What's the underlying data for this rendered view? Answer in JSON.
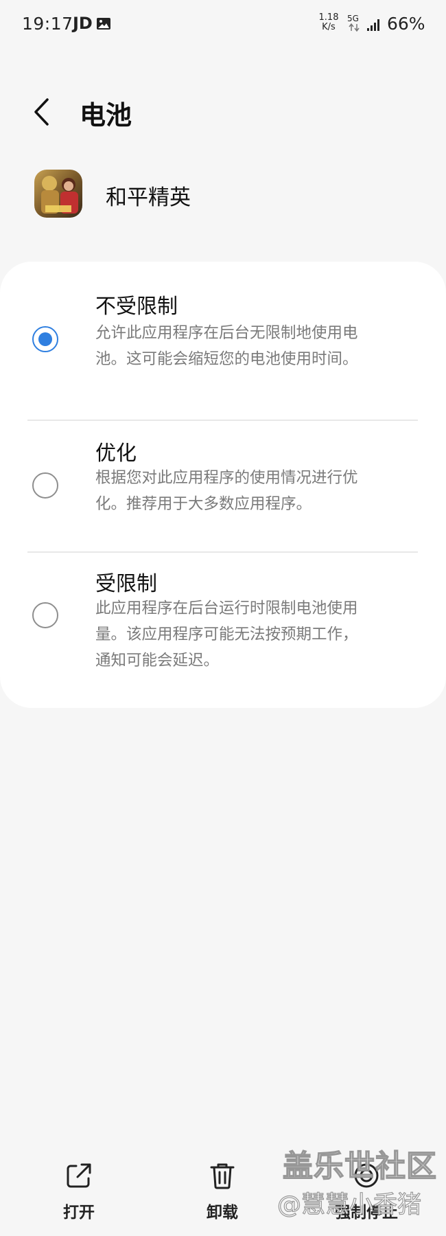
{
  "status_bar": {
    "time": "19:17",
    "carrier_badge": "JD",
    "net_speed_value": "1.18",
    "net_speed_unit": "K/s",
    "network_type": "5G",
    "battery": "66%",
    "icons": [
      "photo-icon",
      "data-arrows-icon",
      "signal-icon"
    ]
  },
  "header": {
    "title": "电池",
    "back_icon": "chevron-left-icon"
  },
  "app": {
    "name": "和平精英",
    "icon": "app-icon"
  },
  "options": [
    {
      "title": "不受限制",
      "description": "允许此应用程序在后台无限制地使用电池。这可能会缩短您的电池使用时间。",
      "selected": true
    },
    {
      "title": "优化",
      "description": "根据您对此应用程序的使用情况进行优化。推荐用于大多数应用程序。",
      "selected": false
    },
    {
      "title": "受限制",
      "description": "此应用程序在后台运行时限制电池使用量。该应用程序可能无法按预期工作，通知可能会延迟。",
      "selected": false
    }
  ],
  "bottom_bar": {
    "open_label": "打开",
    "uninstall_label": "卸载",
    "force_stop_label": "强制停止"
  },
  "watermark": {
    "title": "盖乐世社区",
    "handle": "@慧慧小香猪"
  },
  "colors": {
    "accent": "#2f7fe0",
    "background": "#f6f6f6",
    "card": "#ffffff",
    "secondary_text": "#7a7a7a"
  }
}
